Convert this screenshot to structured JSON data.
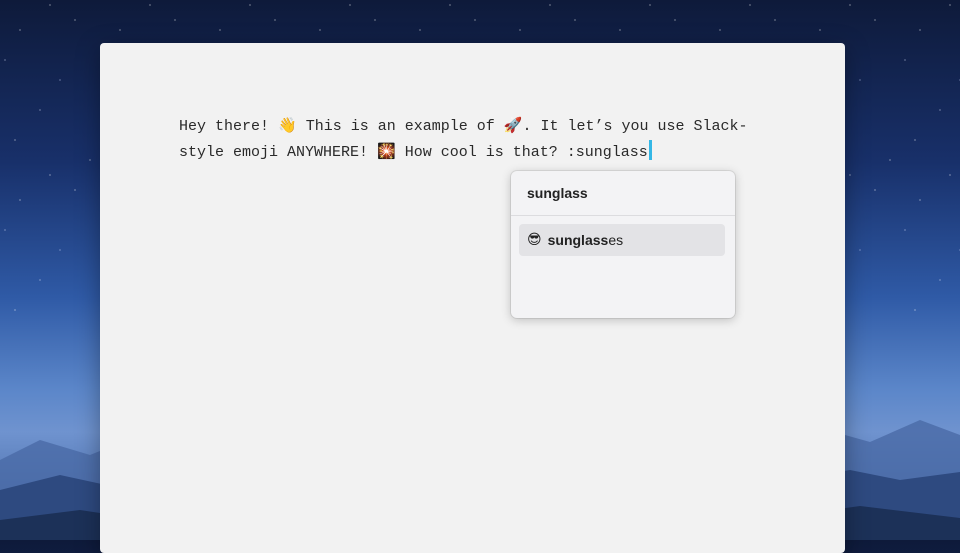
{
  "editor": {
    "line1_a": "Hey there! ",
    "wave_emoji": "👋",
    "line1_b": " This is an example of ",
    "rocket_emoji": "🚀",
    "line1_c": ". It let’s you use Slack-\nstyle emoji ANYWHERE! ",
    "firework_emoji": "🎇",
    "line2_b": " How cool is that? :sunglass"
  },
  "autocomplete": {
    "query": "sunglass",
    "items": [
      {
        "emoji": "😎",
        "match": "sunglass",
        "rest": "es"
      }
    ]
  },
  "colors": {
    "cursor": "#34b7e6",
    "window_bg": "#f2f2f2",
    "selected_item_bg": "#e3e3e6"
  }
}
